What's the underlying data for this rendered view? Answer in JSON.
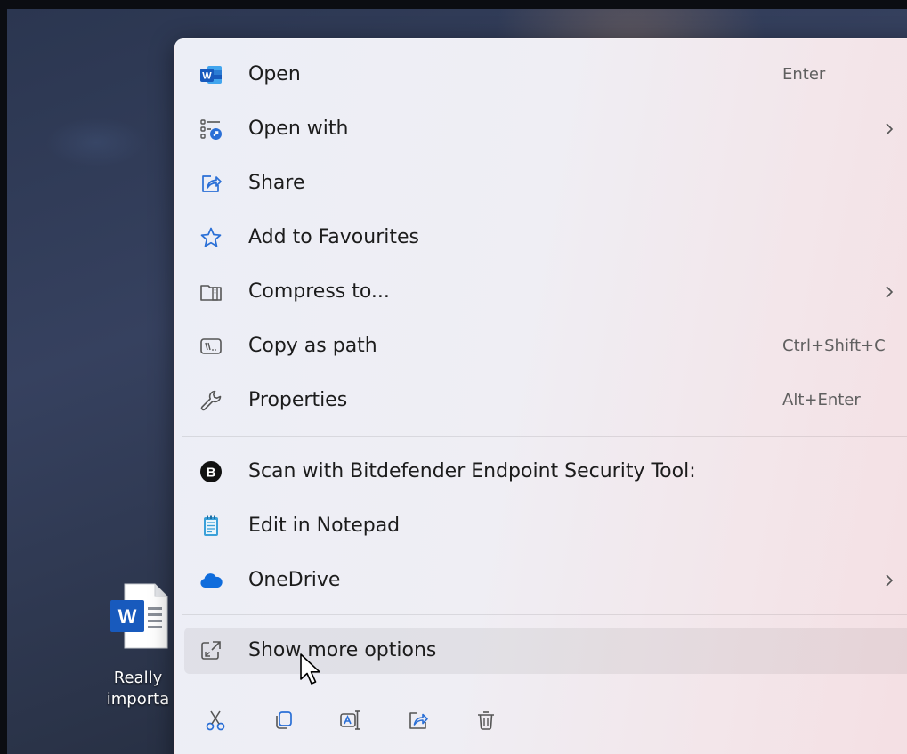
{
  "desktop": {
    "file_label_line1": "Really",
    "file_label_line2": "importa"
  },
  "context_menu": {
    "items": [
      {
        "label": "Open",
        "shortcut": "Enter",
        "icon": "word-icon"
      },
      {
        "label": "Open with",
        "shortcut": "",
        "icon": "open-with-icon",
        "submenu": true
      },
      {
        "label": "Share",
        "shortcut": "",
        "icon": "share-icon"
      },
      {
        "label": "Add to Favourites",
        "shortcut": "",
        "icon": "star-icon"
      },
      {
        "label": "Compress to...",
        "shortcut": "",
        "icon": "zip-folder-icon",
        "submenu": true
      },
      {
        "label": "Copy as path",
        "shortcut": "Ctrl+Shift+C",
        "icon": "copy-path-icon"
      },
      {
        "label": "Properties",
        "shortcut": "Alt+Enter",
        "icon": "wrench-icon"
      }
    ],
    "app_items": [
      {
        "label": "Scan with Bitdefender Endpoint Security Tool:",
        "icon": "bitdefender-icon"
      },
      {
        "label": "Edit in Notepad",
        "icon": "notepad-icon"
      },
      {
        "label": "OneDrive",
        "icon": "cloud-icon",
        "submenu": true
      }
    ],
    "more_options": {
      "label": "Show more options",
      "icon": "expand-icon",
      "highlighted": true
    },
    "action_icons": [
      "cut-icon",
      "copy-icon",
      "rename-icon",
      "share-icon",
      "delete-icon"
    ]
  },
  "colors": {
    "icon_accent": "#2a6fd6",
    "word_blue": "#185abd",
    "onedrive_blue": "#0f6cdc",
    "text": "#1c1c1c",
    "shortcut_text": "#5f5f5f"
  }
}
